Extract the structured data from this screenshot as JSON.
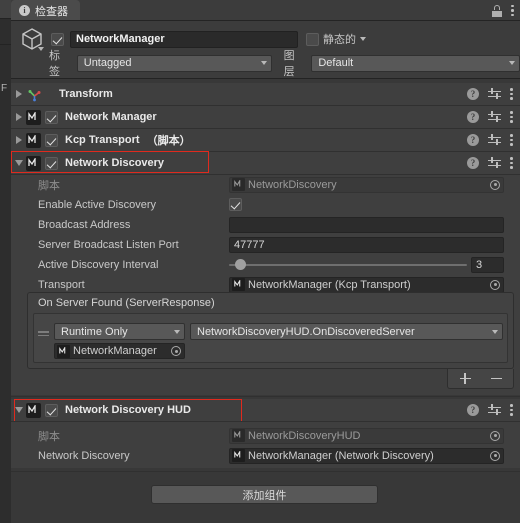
{
  "window": {
    "tab_title": "检查器",
    "tab_icon": "info-icon",
    "lock_icon": "lock-icon",
    "menu_icon": "kebab-menu-icon"
  },
  "gameobject": {
    "icon": "cube-icon",
    "enabled": true,
    "name": "NetworkManager",
    "static_checked": false,
    "static_label": "静态的",
    "tag_label": "标签",
    "tag_value": "Untagged",
    "layer_label": "图层",
    "layer_value": "Default"
  },
  "components": [
    {
      "name": "Transform",
      "suffix": "",
      "icon": "transform-axis-icon",
      "expanded": false,
      "has_toggle": false,
      "enabled": false,
      "highlighted": false
    },
    {
      "name": "Network Manager",
      "suffix": "",
      "icon": "mirror-script-icon",
      "expanded": false,
      "has_toggle": true,
      "enabled": true,
      "highlighted": false
    },
    {
      "name": "Kcp Transport",
      "suffix": "（脚本）",
      "icon": "mirror-script-icon",
      "expanded": false,
      "has_toggle": true,
      "enabled": true,
      "highlighted": false
    },
    {
      "name": "Network Discovery",
      "suffix": "",
      "icon": "mirror-script-icon",
      "expanded": true,
      "has_toggle": true,
      "enabled": true,
      "highlighted": true
    }
  ],
  "row_icons": {
    "help": "help-icon",
    "preset": "preset-sliders-icon",
    "menu": "kebab-menu-icon"
  },
  "network_discovery": {
    "script_label": "脚本",
    "script_value": "NetworkDiscovery",
    "enable_active_discovery_label": "Enable Active Discovery",
    "enable_active_discovery_checked": true,
    "broadcast_address_label": "Broadcast Address",
    "broadcast_address_value": "",
    "server_broadcast_listen_port_label": "Server Broadcast Listen Port",
    "server_broadcast_listen_port_value": "47777",
    "active_discovery_interval_label": "Active Discovery Interval",
    "active_discovery_interval_value": "3",
    "active_discovery_interval_percent": 5,
    "transport_label": "Transport",
    "transport_value": "NetworkManager (Kcp Transport)",
    "event": {
      "title": "On Server Found (ServerResponse)",
      "entries": [
        {
          "mode": "Runtime Only",
          "function": "NetworkDiscoveryHUD.OnDiscoveredServer",
          "target": "NetworkManager"
        }
      ],
      "add_label": "+",
      "remove_label": "−"
    }
  },
  "network_discovery_hud": {
    "header": "Network Discovery HUD",
    "enabled": true,
    "expanded": true,
    "highlighted": true,
    "script_label": "脚本",
    "script_value": "NetworkDiscoveryHUD",
    "network_discovery_label": "Network Discovery",
    "network_discovery_value": "NetworkManager (Network Discovery)"
  },
  "add_component_button": "添加组件",
  "behind_panel_letter": "F",
  "colors": {
    "panel_bg": "#383838",
    "header_bg": "#3c3c3c",
    "component_bg": "#3f3f3f",
    "field_bg": "#2c2c2c",
    "highlight": "#e02a1e",
    "text": "#c9c9c9"
  }
}
